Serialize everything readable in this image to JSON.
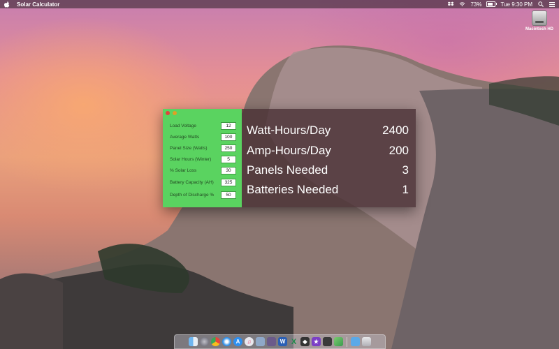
{
  "menubar": {
    "app_name": "Solar Calculator",
    "battery_percent": "73%",
    "battery_level": 0.73,
    "time": "Tue 9:30 PM"
  },
  "desktop": {
    "hd_label": "Macintosh HD"
  },
  "inputs": [
    {
      "label": "Load Voltage",
      "value": "12"
    },
    {
      "label": "Average Watts",
      "value": "100"
    },
    {
      "label": "Panel Size (Watts)",
      "value": "250"
    },
    {
      "label": "Solar Hours (Winter)",
      "value": "5"
    },
    {
      "label": "% Solar Loss",
      "value": "30"
    },
    {
      "label": "Battery Capacity (AH)",
      "value": "325"
    },
    {
      "label": "Depth of Discharge %",
      "value": "50"
    }
  ],
  "results": [
    {
      "label": "Watt-Hours/Day",
      "value": "2400"
    },
    {
      "label": "Amp-Hours/Day",
      "value": "200"
    },
    {
      "label": "Panels Needed",
      "value": "3"
    },
    {
      "label": "Batteries Needed",
      "value": "1"
    }
  ],
  "colors": {
    "panel_green": "#5ad360",
    "results_bg": "#462d32"
  },
  "dock": {
    "icons": [
      "finder-icon",
      "launchpad-icon",
      "chrome-icon",
      "safari-icon",
      "app-store-icon",
      "itunes-icon",
      "preview-icon",
      "photos-icon",
      "word-icon",
      "excel-icon",
      "unity-icon",
      "instruments-icon",
      "terminal-icon",
      "maps-icon",
      "downloads-folder-icon",
      "trash-icon"
    ]
  }
}
